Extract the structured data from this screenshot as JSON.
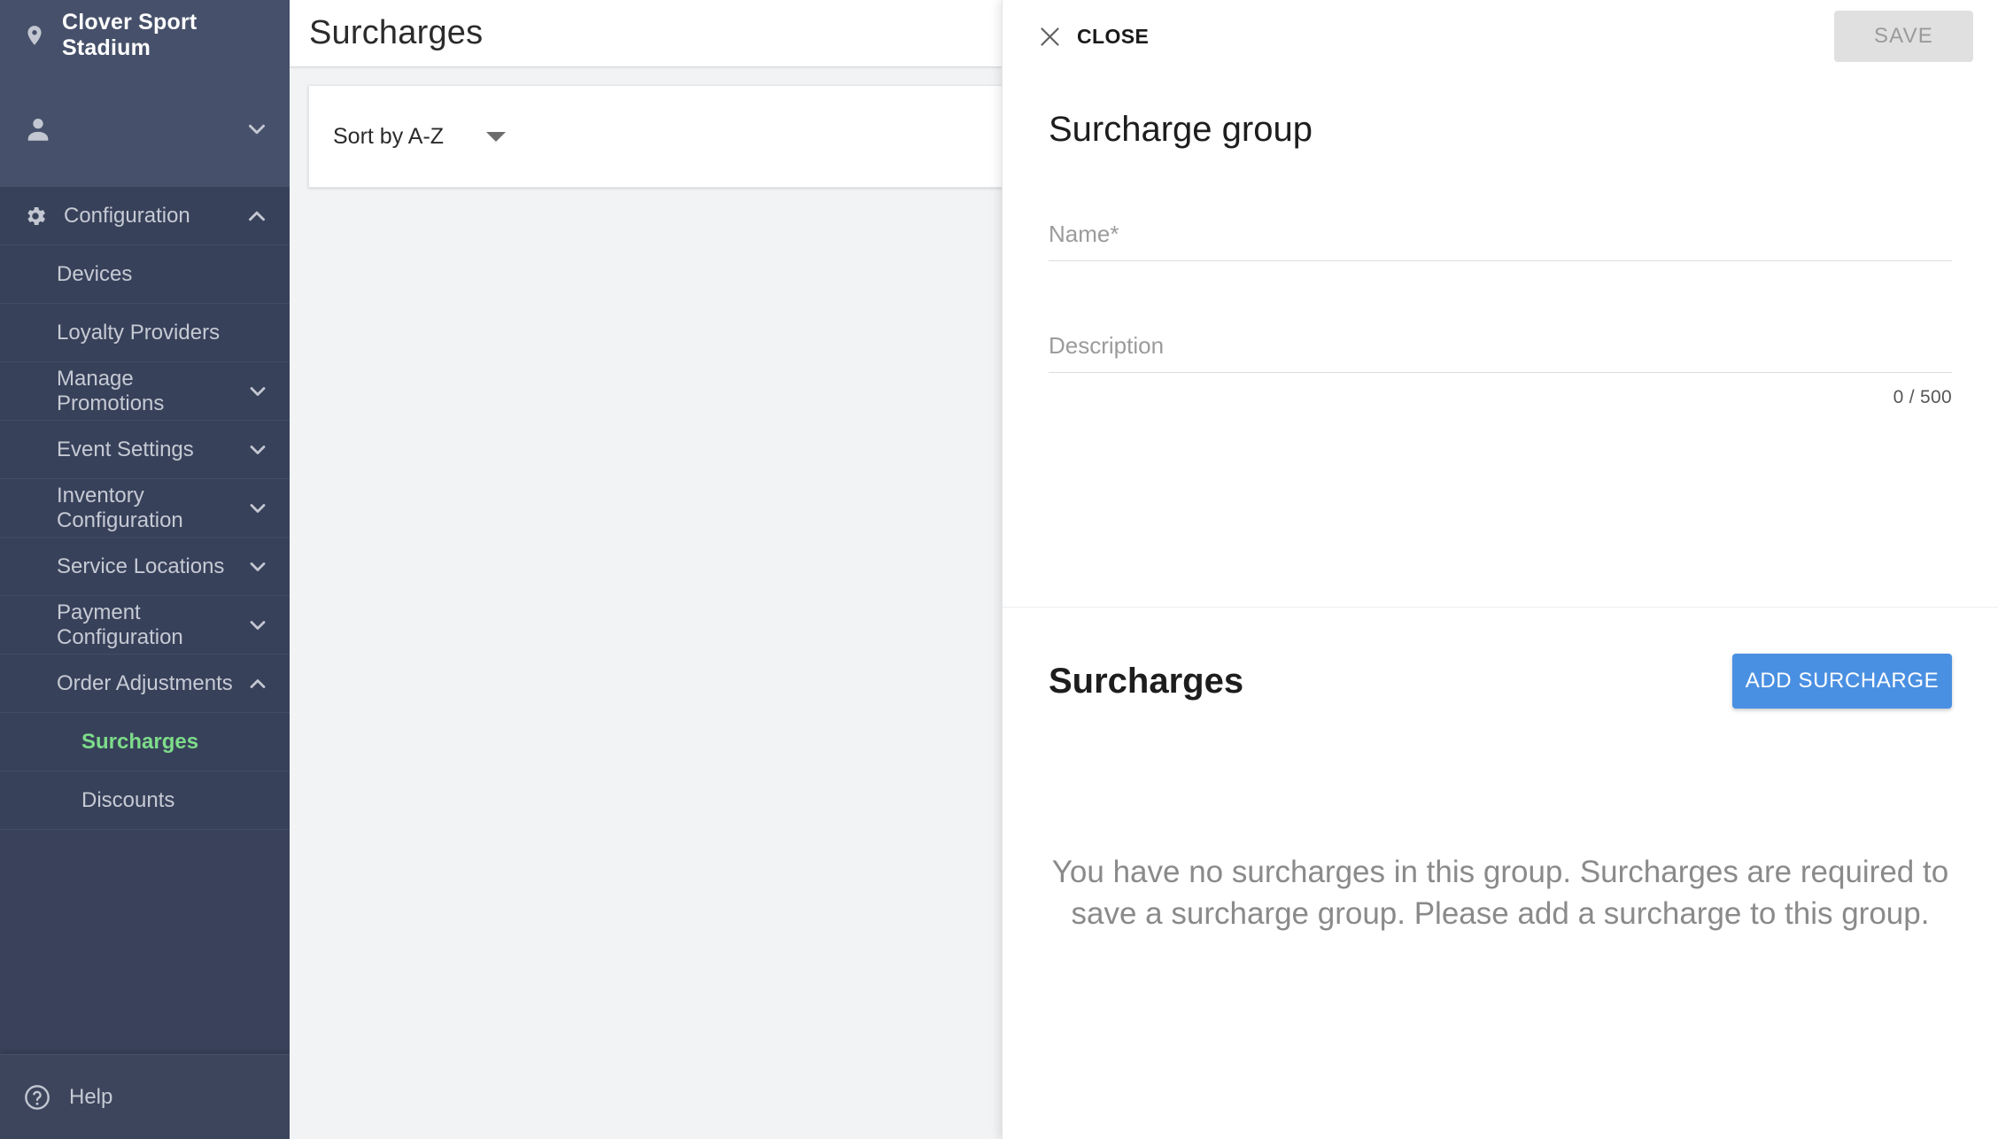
{
  "sidebar": {
    "venue": {
      "label": "Clover Sport Stadium",
      "icon": "location-pin-icon"
    },
    "user": {
      "icon": "person-icon",
      "chevron": "chevron-down-icon"
    },
    "configuration": {
      "label": "Configuration",
      "icon": "gear-icon",
      "chevron": "chevron-up-icon"
    },
    "items": [
      {
        "label": "Devices",
        "expandable": false,
        "active": false
      },
      {
        "label": "Loyalty Providers",
        "expandable": false,
        "active": false
      },
      {
        "label": "Manage Promotions",
        "expandable": true,
        "active": false
      },
      {
        "label": "Event Settings",
        "expandable": true,
        "active": false
      },
      {
        "label": "Inventory Configuration",
        "expandable": true,
        "active": false
      },
      {
        "label": "Service Locations",
        "expandable": true,
        "active": false
      },
      {
        "label": "Payment Configuration",
        "expandable": true,
        "active": false
      },
      {
        "label": "Order Adjustments",
        "expandable": true,
        "expanded": true,
        "active": false
      },
      {
        "label": "Surcharges",
        "expandable": false,
        "active": true,
        "sub": true
      },
      {
        "label": "Discounts",
        "expandable": false,
        "active": false,
        "sub": true
      }
    ],
    "help": {
      "label": "Help",
      "icon": "help-circle-icon"
    }
  },
  "middle": {
    "title": "Surcharges",
    "sort": {
      "value": "Sort by A-Z",
      "caret": "caret-down-icon"
    }
  },
  "drawer": {
    "close_label": "CLOSE",
    "close_icon": "close-x-icon",
    "save_label": "SAVE",
    "group": {
      "title": "Surcharge group",
      "name_placeholder": "Name",
      "name_required_mark": "*",
      "name_value": "",
      "description_placeholder": "Description",
      "description_value": "",
      "description_counter": "0 / 500"
    },
    "surcharges": {
      "title": "Surcharges",
      "add_label": "ADD SURCHARGE",
      "empty_message": "You have no surcharges in this group. Surcharges are required to save a surcharge group. Please add a surcharge to this group."
    }
  },
  "colors": {
    "sidebar_top": "#46506a",
    "sidebar_body": "#38415a",
    "accent_active": "#7ddc8a",
    "primary_button": "#4a90e2",
    "disabled_button": "#e0e0e0"
  }
}
